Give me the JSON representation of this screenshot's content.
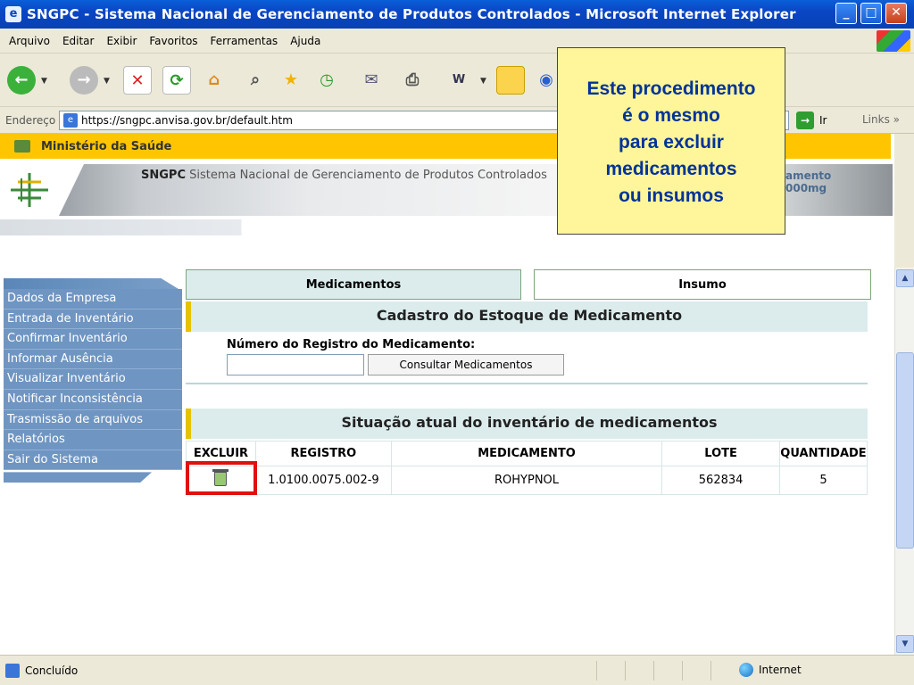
{
  "window": {
    "title": "SNGPC - Sistema Nacional de Gerenciamento de Produtos Controlados - Microsoft Internet Explorer",
    "minimize": "_",
    "maximize": "□",
    "close": "✕"
  },
  "menu": [
    "Arquivo",
    "Editar",
    "Exibir",
    "Favoritos",
    "Ferramentas",
    "Ajuda"
  ],
  "address": {
    "label": "Endereço",
    "url": "https://sngpc.anvisa.gov.br/default.htm",
    "go": "Ir",
    "links": "Links"
  },
  "page": {
    "ministry": "Ministério da Saúde",
    "banner_brand": "SNGPC",
    "banner_text": "Sistema Nacional de Gerenciamento de Produtos Controlados",
    "banner_image_text_1": "amento",
    "banner_image_text_2": "000mg"
  },
  "sidebar": {
    "items": [
      "Dados da Empresa",
      "Entrada de Inventário",
      "Confirmar Inventário",
      "Informar Ausência",
      "Visualizar Inventário",
      "Notificar Inconsistência",
      "Trasmissão de arquivos",
      "Relatórios",
      "Sair do Sistema"
    ]
  },
  "tabs": {
    "active": "Medicamentos",
    "inactive": "Insumo"
  },
  "form": {
    "header": "Cadastro do Estoque de Medicamento",
    "label": "Número do Registro do Medicamento:",
    "input_value": "",
    "button": "Consultar Medicamentos"
  },
  "inventory": {
    "header": "Situação atual do inventário de medicamentos",
    "columns": [
      "EXCLUIR",
      "REGISTRO",
      "MEDICAMENTO",
      "LOTE",
      "QUANTIDADE"
    ],
    "rows": [
      {
        "registro": "1.0100.0075.002-9",
        "medicamento": "ROHYPNOL",
        "lote": "562834",
        "quantidade": "5"
      }
    ]
  },
  "callout": {
    "lines": [
      "Este procedimento",
      "é o mesmo",
      "para excluir",
      "medicamentos",
      "ou insumos"
    ]
  },
  "status": {
    "text": "Concluído",
    "zone": "Internet"
  },
  "colors": {
    "ministry_bar": "#ffc600",
    "sidebar": "#6f95c2",
    "callout_bg": "#fff59a",
    "callout_text": "#003399",
    "highlight": "#e01010"
  }
}
